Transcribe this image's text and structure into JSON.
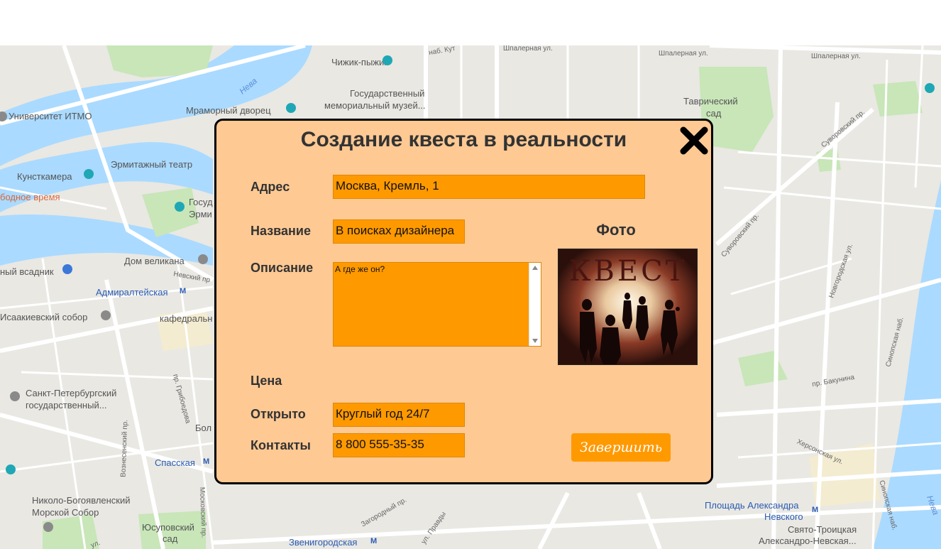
{
  "map": {
    "labels": {
      "itmo": "Университет ИТМО",
      "chizhik": "Чижик-пыжик",
      "memorial": "Государственный",
      "memorial2": "мемориальный музей...",
      "marble": "Мраморный дворец",
      "neva1": "Нева",
      "neva2": "Нева",
      "kunst": "Кунсткамера",
      "hermitage_theatre": "Эрмитажный театр",
      "free_time": "бодное время",
      "gos_erm1": "Госуд",
      "gos_erm2": "Эрми",
      "dom_velikana": "Дом великана",
      "nevsky_pr": "Невский пр",
      "horseman": "ный всадник",
      "admiralteyskaya": "Адмиралтейская",
      "isaac": "Исаакиевский собор",
      "kazan": "кафедральн",
      "spbgu1": "Санкт-Петербургский",
      "spbgu2": "государственный...",
      "griboedova": "пр. Грибоедова",
      "bol": "Бол",
      "voznesensky": "Вознесенский пр.",
      "spasskaya": "Спасская",
      "moskovsky": "Московский пр.",
      "nikolo1": "Николо-Богоявленский",
      "nikolo2": "Морской Собор",
      "yusupov1": "Юсуповский",
      "yusupov2": "сад",
      "zagorodny": "Загородный пр.",
      "pravdy": "ул. Правды",
      "zvenigorodskaya": "Звенигородская",
      "shpalernaya1": "Шпалерная ул.",
      "shpalernaya2": "Шпалерная ул.",
      "shpalernaya3": "Шпалерная ул.",
      "tavrich1": "Таврический",
      "tavrich2": "сад",
      "suvorovsky1": "Суворовский пр.",
      "suvorovsky2": "Суворовский пр.",
      "novgorodskaya": "Новгородская ул.",
      "sinopskaya": "Синопская наб.",
      "bakunina": "пр. Бакунина",
      "khersonskaya": "Херсонская ул.",
      "nevsky_sq1": "Площадь Александра",
      "nevsky_sq2": "Невского",
      "lavra1": "Свято-Троицкая",
      "lavra2": "Александро-Невская...",
      "neva3": "Нева",
      "kut": "наб. Кут",
      "sinopskaya2": "Синопская наб.",
      "pravdy2": "ул."
    },
    "metro_symbol": "M"
  },
  "modal": {
    "title": "Создание квеста в реальности",
    "photo_title": "Фото",
    "photo_text": "КВЕСТ",
    "finish_label": "Завершить",
    "fields": {
      "address_label": "Адрес",
      "address_value": "Москва, Кремль, 1",
      "name_label": "Название",
      "name_value": "В поисках дизайнера",
      "desc_label": "Описание",
      "desc_value": "А где же он?",
      "price_label": "Цена",
      "open_label": "Открыто",
      "open_value": "Круглый год 24/7",
      "contacts_label": "Контакты",
      "contacts_value": "8 800 555-35-35"
    }
  },
  "colors": {
    "modal_bg": "#fec993",
    "field_bg": "#ff9900",
    "water": "#aadaff",
    "park": "#c8e6b8"
  }
}
